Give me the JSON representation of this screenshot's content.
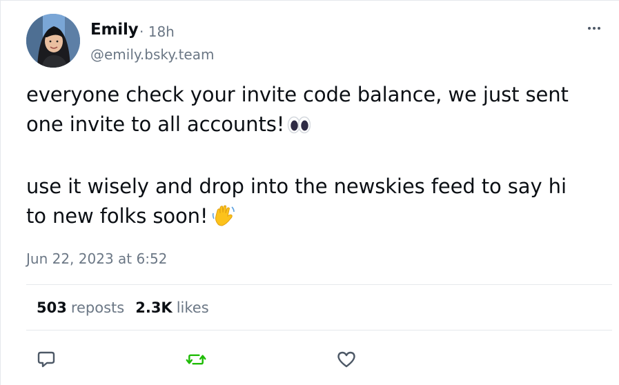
{
  "author": {
    "display_name": "Emily",
    "separator": "·",
    "time_ago": "18h",
    "handle": "@emily.bsky.team"
  },
  "post": {
    "paragraph1_line1": "everyone check your invite code balance, we just sent",
    "paragraph1_line2": "one invite to all accounts!",
    "paragraph1_emoji": "eyes",
    "paragraph2_line1": "use it wisely and drop into the newskies feed to say hi",
    "paragraph2_line2": "to new folks soon!",
    "paragraph2_emoji": "waving-hand",
    "timestamp": "Jun 22, 2023 at 6:52"
  },
  "stats": {
    "reposts_count": "503",
    "reposts_label": "reposts",
    "likes_count": "2.3K",
    "likes_label": "likes"
  },
  "actions": {
    "reply_icon": "reply-icon",
    "repost_icon": "repost-icon",
    "like_icon": "like-icon",
    "more_icon": "ellipsis-icon"
  },
  "colors": {
    "text_primary": "#0b0f14",
    "text_secondary": "#6b7785",
    "repost_green": "#20bc07",
    "divider": "#e5e8ec"
  }
}
